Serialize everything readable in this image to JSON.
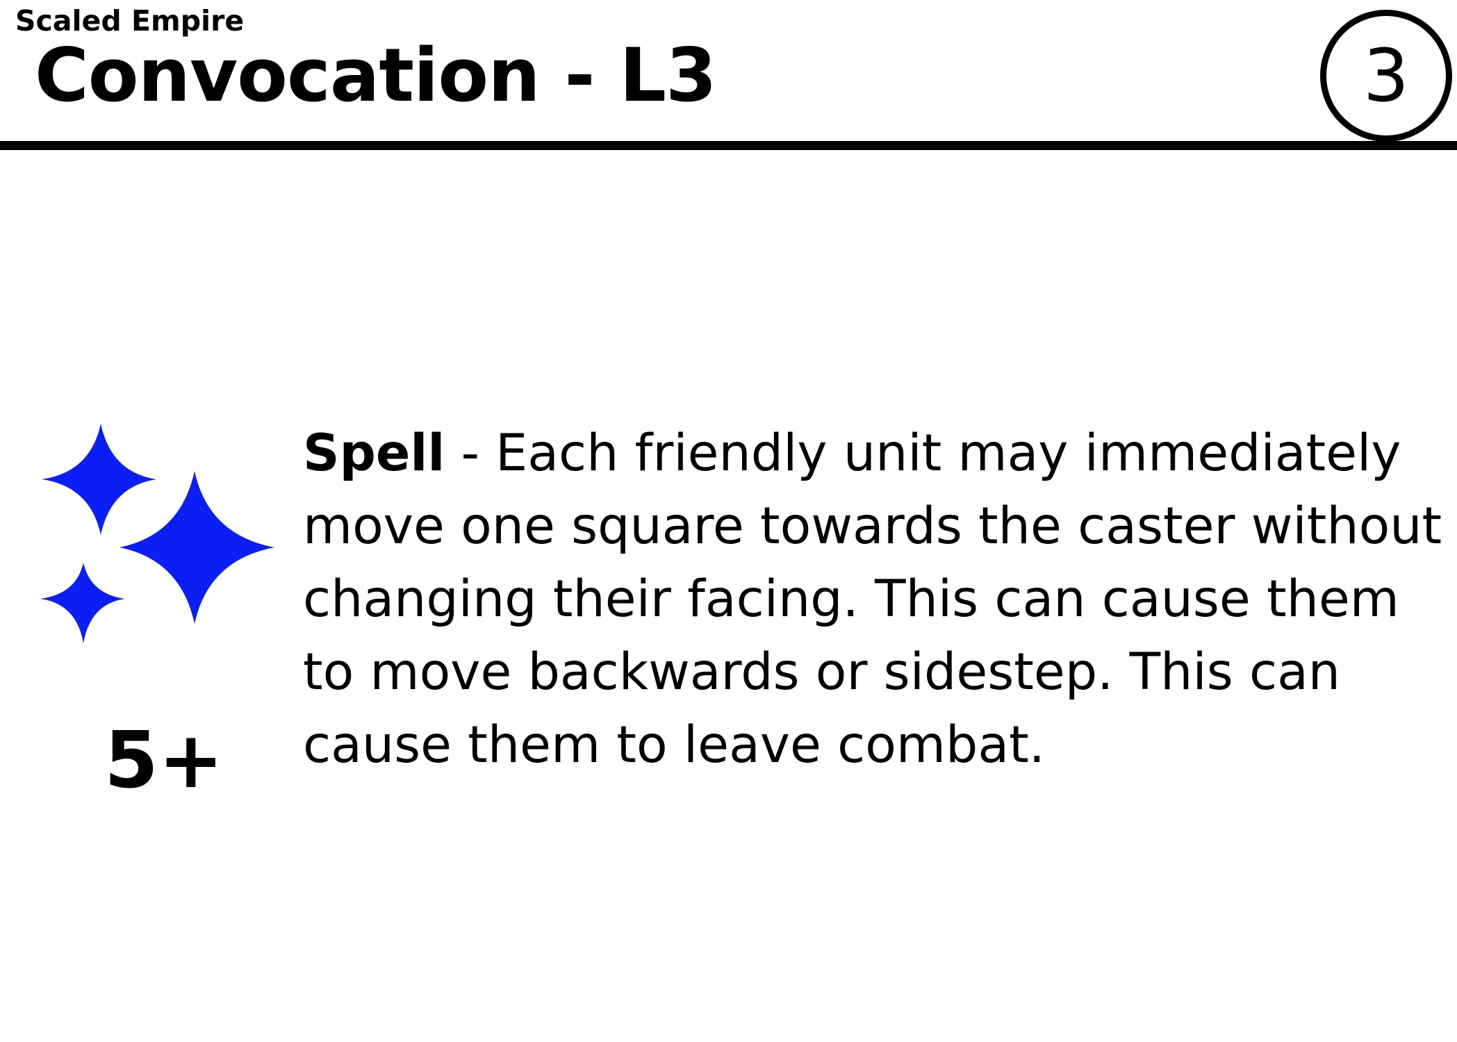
{
  "card": {
    "faction": "Scaled Empire",
    "title": "Convocation - L3",
    "level": "3"
  },
  "ability": {
    "icon": "sparkles-icon",
    "icon_color": "#0a1ef5",
    "cast_value": "5+",
    "type_label": "Spell",
    "separator": " - ",
    "description": "Each friendly unit may immediately move one square towards the caster without changing their facing. This can cause them to move backwards or sidestep. This can cause them to leave combat."
  }
}
